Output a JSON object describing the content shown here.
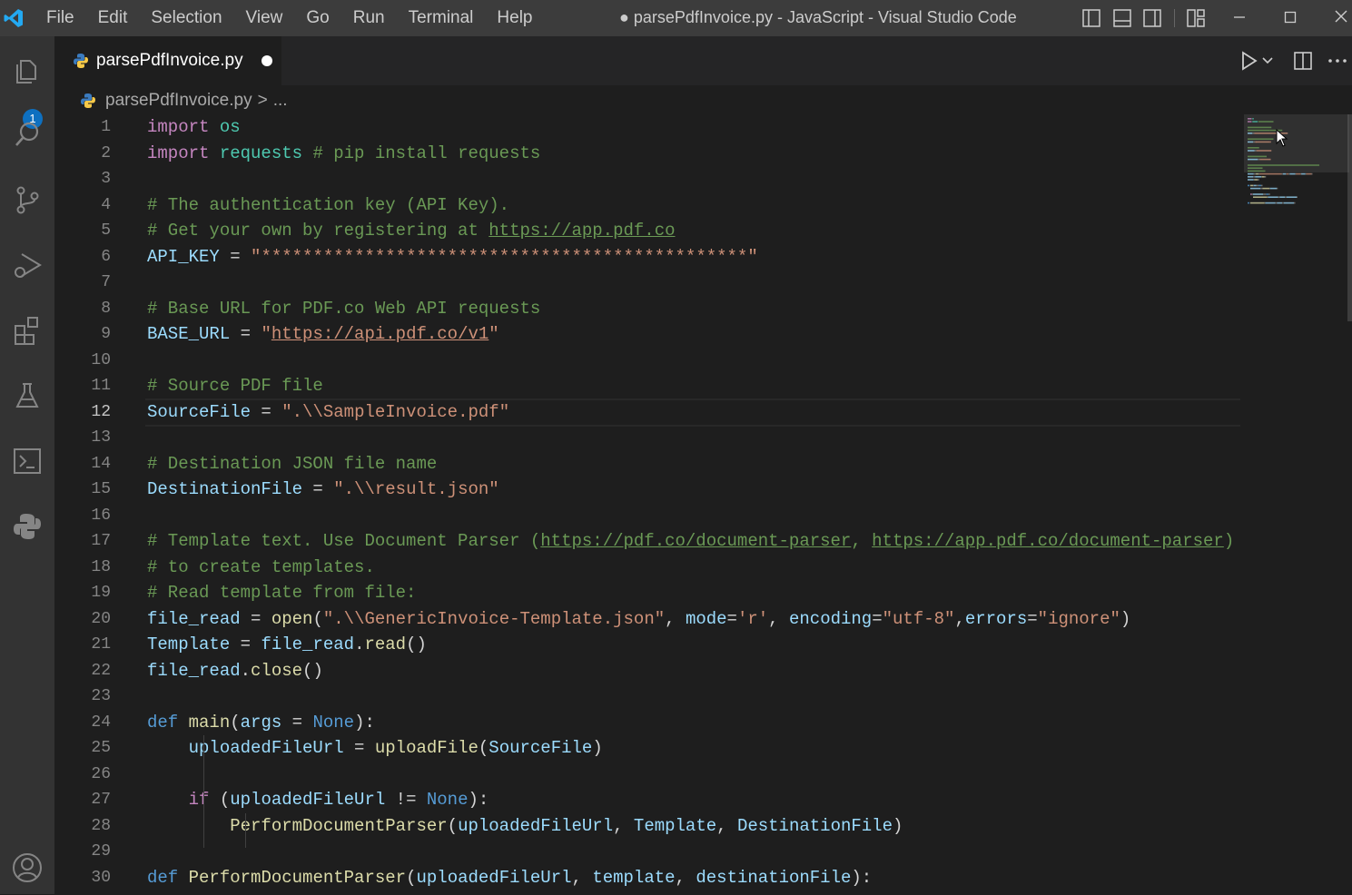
{
  "window": {
    "title": "● parsePdfInvoice.py - JavaScript - Visual Studio Code",
    "menu": [
      "File",
      "Edit",
      "Selection",
      "View",
      "Go",
      "Run",
      "Terminal",
      "Help"
    ]
  },
  "activity_bar": {
    "items": [
      {
        "name": "explorer-icon"
      },
      {
        "name": "search-icon"
      },
      {
        "name": "source-control-icon"
      },
      {
        "name": "run-debug-icon"
      },
      {
        "name": "extensions-icon"
      },
      {
        "name": "testing-icon"
      },
      {
        "name": "terminal-icon"
      },
      {
        "name": "python-icon"
      }
    ],
    "explorer_badge": "1",
    "account": "account-icon"
  },
  "tab": {
    "label": "parsePdfInvoice.py",
    "dirty": true
  },
  "breadcrumb": {
    "file": "parsePdfInvoice.py",
    "separator": ">",
    "tail": "..."
  },
  "editor": {
    "active_line": 12,
    "line_numbers": [
      "1",
      "2",
      "3",
      "4",
      "5",
      "6",
      "7",
      "8",
      "9",
      "10",
      "11",
      "12",
      "13",
      "14",
      "15",
      "16",
      "17",
      "18",
      "19",
      "20",
      "21",
      "22",
      "23",
      "24",
      "25",
      "26",
      "27",
      "28",
      "29",
      "30"
    ],
    "colors": {
      "keyword": "#c586c0",
      "builtin": "#569cd6",
      "module": "#4ec9b0",
      "comment": "#6a9955",
      "string": "#ce9178",
      "variable": "#9cdcfe",
      "function": "#dcdcaa"
    },
    "lines": [
      [
        [
          "kw",
          "import"
        ],
        [
          "pn",
          " "
        ],
        [
          "mod",
          "os"
        ]
      ],
      [
        [
          "kw",
          "import"
        ],
        [
          "pn",
          " "
        ],
        [
          "mod",
          "requests"
        ],
        [
          "pn",
          " "
        ],
        [
          "cm",
          "# pip install requests"
        ]
      ],
      [],
      [
        [
          "cm",
          "# The authentication key (API Key)."
        ]
      ],
      [
        [
          "cm",
          "# Get your own by registering at "
        ],
        [
          "cm link",
          "https://app.pdf.co"
        ]
      ],
      [
        [
          "var",
          "API_KEY"
        ],
        [
          "pn",
          " = "
        ],
        [
          "str",
          "\"***********************************************\""
        ]
      ],
      [],
      [
        [
          "cm",
          "# Base URL for PDF.co Web API requests"
        ]
      ],
      [
        [
          "var",
          "BASE_URL"
        ],
        [
          "pn",
          " = "
        ],
        [
          "str",
          "\""
        ],
        [
          "str link",
          "https://api.pdf.co/v1"
        ],
        [
          "str",
          "\""
        ]
      ],
      [],
      [
        [
          "cm",
          "# Source PDF file"
        ]
      ],
      [
        [
          "var",
          "SourceFile"
        ],
        [
          "pn",
          " = "
        ],
        [
          "str",
          "\".\\\\SampleInvoice.pdf\""
        ]
      ],
      [],
      [
        [
          "cm",
          "# Destination JSON file name"
        ]
      ],
      [
        [
          "var",
          "DestinationFile"
        ],
        [
          "pn",
          " = "
        ],
        [
          "str",
          "\".\\\\result.json\""
        ]
      ],
      [],
      [
        [
          "cm",
          "# Template text. Use Document Parser ("
        ],
        [
          "cm link",
          "https://pdf.co/document-parser"
        ],
        [
          "cm",
          ", "
        ],
        [
          "cm link",
          "https://app.pdf.co/document-parser"
        ],
        [
          "cm",
          ")"
        ]
      ],
      [
        [
          "cm",
          "# to create templates."
        ]
      ],
      [
        [
          "cm",
          "# Read template from file:"
        ]
      ],
      [
        [
          "var",
          "file_read"
        ],
        [
          "pn",
          " = "
        ],
        [
          "fn",
          "open"
        ],
        [
          "pn",
          "("
        ],
        [
          "str",
          "\".\\\\GenericInvoice-Template.json\""
        ],
        [
          "pn",
          ", "
        ],
        [
          "var",
          "mode"
        ],
        [
          "pn",
          "="
        ],
        [
          "str",
          "'r'"
        ],
        [
          "pn",
          ", "
        ],
        [
          "var",
          "encoding"
        ],
        [
          "pn",
          "="
        ],
        [
          "str",
          "\"utf-8\""
        ],
        [
          "pn",
          ","
        ],
        [
          "var",
          "errors"
        ],
        [
          "pn",
          "="
        ],
        [
          "str",
          "\"ignore\""
        ],
        [
          "pn",
          ")"
        ]
      ],
      [
        [
          "var",
          "Template"
        ],
        [
          "pn",
          " = "
        ],
        [
          "var",
          "file_read"
        ],
        [
          "pn",
          "."
        ],
        [
          "fn",
          "read"
        ],
        [
          "pn",
          "()"
        ]
      ],
      [
        [
          "var",
          "file_read"
        ],
        [
          "pn",
          "."
        ],
        [
          "fn",
          "close"
        ],
        [
          "pn",
          "()"
        ]
      ],
      [],
      [
        [
          "kwb",
          "def"
        ],
        [
          "pn",
          " "
        ],
        [
          "fn",
          "main"
        ],
        [
          "pn",
          "("
        ],
        [
          "var",
          "args"
        ],
        [
          "pn",
          " = "
        ],
        [
          "kwb",
          "None"
        ],
        [
          "pn",
          "):"
        ]
      ],
      [
        [
          "pn",
          "    "
        ],
        [
          "var",
          "uploadedFileUrl"
        ],
        [
          "pn",
          " = "
        ],
        [
          "fn",
          "uploadFile"
        ],
        [
          "pn",
          "("
        ],
        [
          "var",
          "SourceFile"
        ],
        [
          "pn",
          ")"
        ]
      ],
      [],
      [
        [
          "pn",
          "    "
        ],
        [
          "kw",
          "if"
        ],
        [
          "pn",
          " ("
        ],
        [
          "var",
          "uploadedFileUrl"
        ],
        [
          "pn",
          " != "
        ],
        [
          "kwb",
          "None"
        ],
        [
          "pn",
          "):"
        ]
      ],
      [
        [
          "pn",
          "        "
        ],
        [
          "fn",
          "PerformDocumentParser"
        ],
        [
          "pn",
          "("
        ],
        [
          "var",
          "uploadedFileUrl"
        ],
        [
          "pn",
          ", "
        ],
        [
          "var",
          "Template"
        ],
        [
          "pn",
          ", "
        ],
        [
          "var",
          "DestinationFile"
        ],
        [
          "pn",
          ")"
        ]
      ],
      [],
      [
        [
          "kwb",
          "def"
        ],
        [
          "pn",
          " "
        ],
        [
          "fn",
          "PerformDocumentParser"
        ],
        [
          "pn",
          "("
        ],
        [
          "var",
          "uploadedFileUrl"
        ],
        [
          "pn",
          ", "
        ],
        [
          "var",
          "template"
        ],
        [
          "pn",
          ", "
        ],
        [
          "var",
          "destinationFile"
        ],
        [
          "pn",
          "):"
        ]
      ]
    ]
  }
}
